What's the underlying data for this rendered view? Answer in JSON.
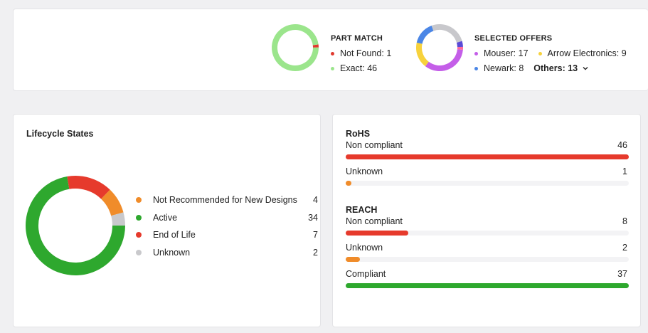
{
  "part_match": {
    "title": "PART MATCH",
    "items": [
      {
        "label": "Not Found: 1",
        "value": 1,
        "color": "#e03a2f"
      },
      {
        "label": "Exact: 46",
        "value": 46,
        "color": "#9be58c"
      }
    ]
  },
  "selected_offers": {
    "title": "SELECTED OFFERS",
    "items": [
      {
        "label": "Mouser: 17",
        "value": 17,
        "color": "#c45ee8"
      },
      {
        "label": "Arrow Electronics: 9",
        "value": 9,
        "color": "#f7d23c"
      },
      {
        "label": "Newark: 8",
        "value": 8,
        "color": "#4b86e6"
      },
      {
        "label": "Others: 13",
        "value": 13,
        "color": "#c8c8cc"
      }
    ],
    "extra_segments": [
      {
        "value": 2,
        "color": "#5a4ad6"
      },
      {
        "value": 1,
        "color": "#ff6b9a"
      }
    ]
  },
  "lifecycle": {
    "title": "Lifecycle States",
    "items": [
      {
        "label": "Not Recommended for New Designs",
        "count": "4",
        "value": 4,
        "color": "#f08c2a"
      },
      {
        "label": "Active",
        "count": "34",
        "value": 34,
        "color": "#2ea82e"
      },
      {
        "label": "End of Life",
        "count": "7",
        "value": 7,
        "color": "#e63a2c"
      },
      {
        "label": "Unknown",
        "count": "2",
        "value": 2,
        "color": "#c9c9cc"
      }
    ]
  },
  "rohs": {
    "title": "RoHS",
    "rows": [
      {
        "label": "Non compliant",
        "count": "46",
        "fraction": 1.0,
        "color": "#e63a2c"
      },
      {
        "label": "Unknown",
        "count": "1",
        "fraction": 0.02,
        "color": "#f08c2a"
      }
    ]
  },
  "reach": {
    "title": "REACH",
    "rows": [
      {
        "label": "Non compliant",
        "count": "8",
        "fraction": 0.22,
        "color": "#e63a2c"
      },
      {
        "label": "Unknown",
        "count": "2",
        "fraction": 0.05,
        "color": "#f08c2a"
      },
      {
        "label": "Compliant",
        "count": "37",
        "fraction": 1.0,
        "color": "#2ea82e"
      }
    ]
  }
}
